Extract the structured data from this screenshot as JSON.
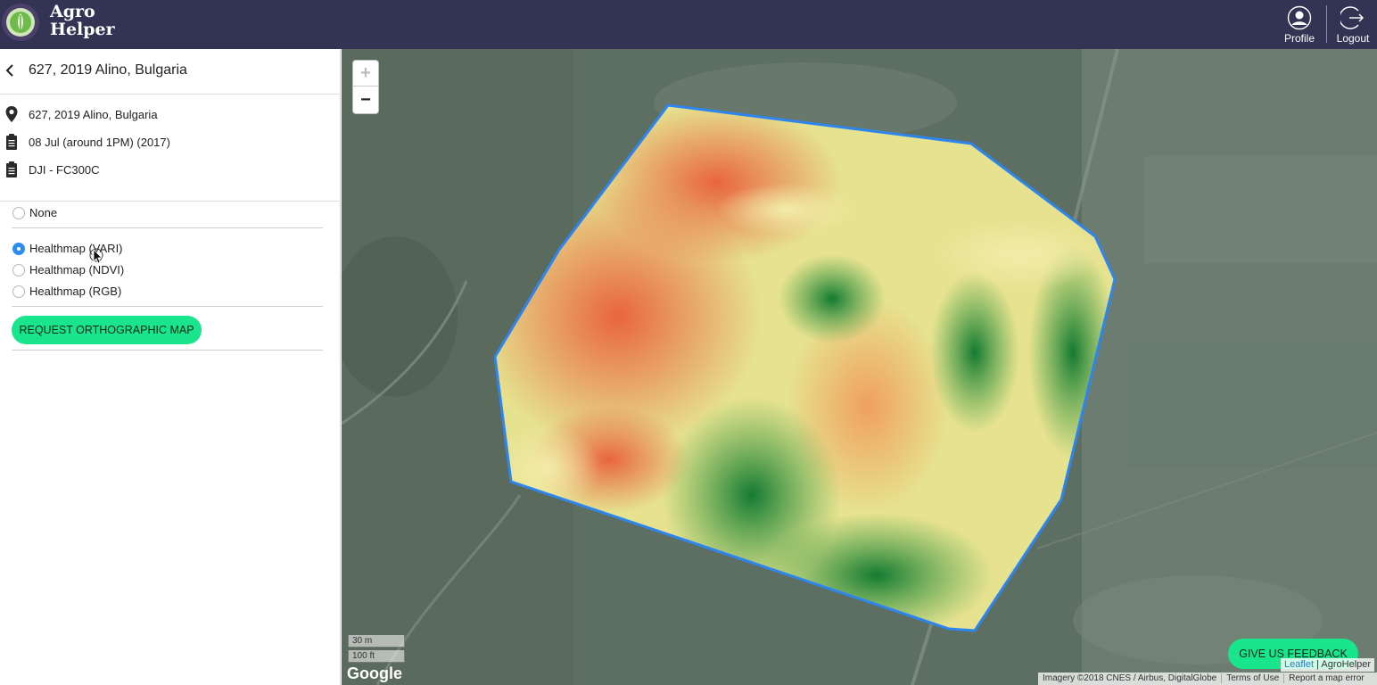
{
  "header": {
    "brand_line1": "Agro",
    "brand_line2": "Helper",
    "profile_label": "Profile",
    "logout_label": "Logout"
  },
  "sidebar": {
    "title": "627, 2019 Alino, Bulgaria",
    "info": {
      "location": "627, 2019 Alino, Bulgaria",
      "date": "08 Jul (around 1PM) (2017)",
      "device": "DJI - FC300C"
    },
    "layers": [
      {
        "label": "None",
        "selected": false
      },
      {
        "label": "Healthmap (VARI)",
        "selected": true
      },
      {
        "label": "Healthmap (NDVI)",
        "selected": false
      },
      {
        "label": "Healthmap (RGB)",
        "selected": false
      }
    ],
    "request_button": "REQUEST ORTHOGRAPHIC MAP"
  },
  "map": {
    "zoom_in": "+",
    "zoom_out": "−",
    "scale_metric": "30 m",
    "scale_imperial": "100 ft",
    "google_logo": "Google",
    "feedback_button": "GIVE US FEEDBACK",
    "attribution_leaflet": "Leaflet",
    "attribution_sep": "|",
    "attribution_owner": "AgroHelper",
    "imagery_credit": "Imagery ©2018 CNES / Airbus, DigitalGlobe",
    "terms": "Terms of Use",
    "report": "Report a map error",
    "field_outline_color": "#2d86f0"
  }
}
